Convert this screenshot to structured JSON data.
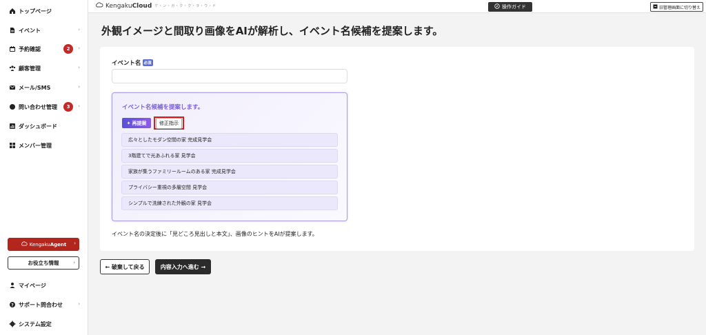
{
  "sidebar": {
    "items": [
      {
        "label": "トップページ",
        "icon": "home-icon"
      },
      {
        "label": "イベント",
        "icon": "document-icon",
        "chevron": true
      },
      {
        "label": "予約確認",
        "icon": "calendar-icon",
        "chevron": true,
        "badge": "2"
      },
      {
        "label": "顧客管理",
        "icon": "people-icon",
        "chevron": true
      },
      {
        "label": "メール/SMS",
        "icon": "mail-icon",
        "chevron": true
      },
      {
        "label": "問い合わせ管理",
        "icon": "chat-icon",
        "chevron": true,
        "badge": "3"
      },
      {
        "label": "ダッシュボード",
        "icon": "chart-icon"
      },
      {
        "label": "メンバー管理",
        "icon": "grid-icon"
      }
    ],
    "agent_button": {
      "prefix": "Kengaku",
      "suffix": "Agent"
    },
    "tips_button": "お役立ち情報",
    "bottom_items": [
      {
        "label": "マイページ",
        "icon": "user-icon"
      },
      {
        "label": "サポート問合わせ",
        "icon": "help-icon",
        "chevron": true
      },
      {
        "label": "システム設定",
        "icon": "gear-icon"
      }
    ]
  },
  "topbar": {
    "logo_prefix": "Kengaku",
    "logo_suffix": "Cloud",
    "logo_tag": "ケ・ン・ガ・ク・ク・ラ・ウ・ド",
    "guide_button": "操作ガイド",
    "switch_button": "旧管理画面に切り替え"
  },
  "main": {
    "title": "外観イメージと間取り画像をAIが解析し、イベント名候補を提案します。",
    "event_name_label": "イベント名",
    "required_badge": "必須",
    "event_name_value": "",
    "suggest": {
      "title": "イベント名候補を提案します。",
      "regen_button": "再提案",
      "fix_button": "修正指示",
      "candidates": [
        "広々としたモダン空間の家 完成見学会",
        "3階建てで光あふれる家 見学会",
        "家族が集うファミリールームのある家 完成見学会",
        "プライバシー重視の多層空間 見学会",
        "シンプルで洗練された外観の家 見学会"
      ]
    },
    "hint": "イベント名の決定後に「見どころ見出しと本文」、画像のヒントをAIが提案します。"
  },
  "footer_buttons": {
    "back": "← 破棄して戻る",
    "next": "内容入力へ進む →"
  },
  "colors": {
    "accent_purple": "#7a60d8",
    "agent_red": "#b3261e",
    "badge_red": "#c62828",
    "highlight_red": "#d81b1b"
  }
}
